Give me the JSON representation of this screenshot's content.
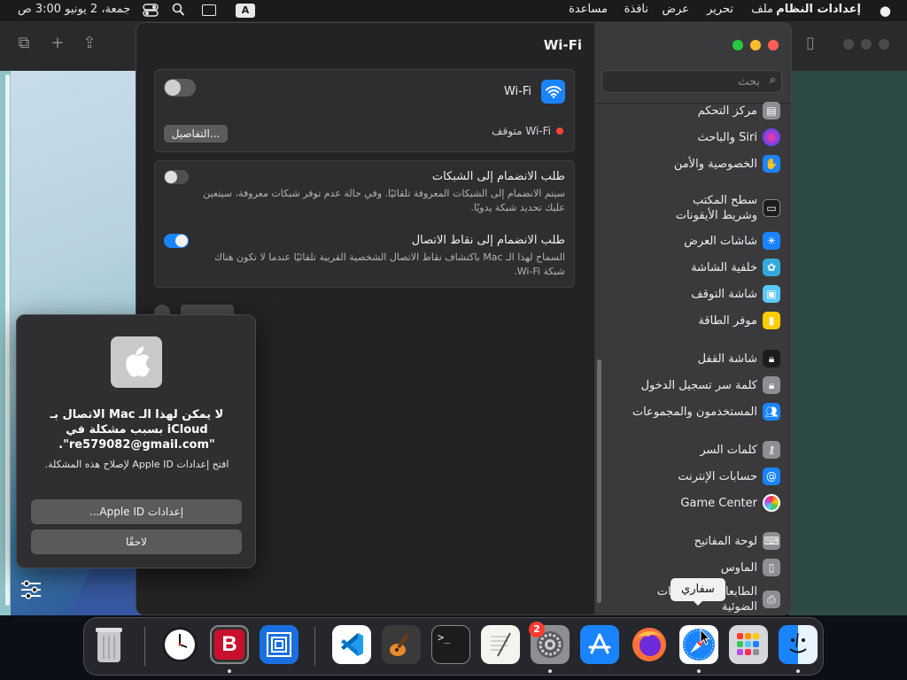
{
  "menubar": {
    "apple": "",
    "app_name": "إعدادات النظام",
    "file": "ملف",
    "edit": "تحرير",
    "view": "عرض",
    "window": "نافذة",
    "help": "مساعدة",
    "input_source": "A",
    "datetime": "جمعة، 2 يونيو  3:00 ص"
  },
  "sidebar": {
    "search_placeholder": "بحث",
    "items": [
      {
        "label": "مركز التحكم",
        "icon": "control-center-icon",
        "color": "#8e8e93"
      },
      {
        "label": "Siri والباحث",
        "icon": "siri-icon",
        "color": "#7b3fe4"
      },
      {
        "label": "الخصوصية والأمن",
        "icon": "privacy-hand-icon",
        "color": "#1a84ff"
      },
      {
        "label": "سطح المكتب وشريط الأيقونات",
        "icon": "dock-icon",
        "color": "#1c1c1e"
      },
      {
        "label": "شاشات العرض",
        "icon": "display-icon",
        "color": "#1a84ff"
      },
      {
        "label": "خلفية الشاشة",
        "icon": "wallpaper-icon",
        "color": "#34aadc"
      },
      {
        "label": "شاشة التوقف",
        "icon": "screensaver-icon",
        "color": "#5ac8fa"
      },
      {
        "label": "موفر الطاقة",
        "icon": "battery-icon",
        "color": "#ffcc00"
      },
      {
        "label": "شاشة القفل",
        "icon": "lock-screen-icon",
        "color": "#1c1c1e"
      },
      {
        "label": "كلمة سر تسجيل الدخول",
        "icon": "lock-icon",
        "color": "#8e8e93"
      },
      {
        "label": "المستخدمون والمجموعات",
        "icon": "users-icon",
        "color": "#1a84ff"
      },
      {
        "label": "كلمات السر",
        "icon": "key-icon",
        "color": "#8e8e93"
      },
      {
        "label": "حسابات الإنترنت",
        "icon": "at-icon",
        "color": "#1a84ff"
      },
      {
        "label": "Game Center",
        "icon": "game-center-icon",
        "color": "#ffffff"
      },
      {
        "label": "لوحة المفاتيح",
        "icon": "keyboard-icon",
        "color": "#8e8e93"
      },
      {
        "label": "الماوس",
        "icon": "mouse-icon",
        "color": "#8e8e93"
      },
      {
        "label": "الطابعات والماسحات الضوئية",
        "icon": "printer-icon",
        "color": "#8e8e93"
      }
    ]
  },
  "content": {
    "title": "Wi-Fi",
    "wifi_label": "Wi-Fi",
    "wifi_on": false,
    "wifi_status": "Wi-Fi متوقف",
    "details_button": "التفاصيل...",
    "ask_join_title": "طلب الانضمام إلى الشبكات",
    "ask_join_desc": "سيتم الانضمام إلى الشبكات المعروفة تلقائيًا. وفي حالة عدم توفر شبكات معروفة، سيتعين عليك تحديد شبكة يدويًا.",
    "ask_join_on": false,
    "hotspot_title": "طلب الانضمام إلى نقاط الاتصال",
    "hotspot_desc": "السماح لهذا الـ Mac باكتشاف نقاط الاتصال الشخصية القريبة تلقائيًا عندما لا تكون هناك شبكة Wi-Fi.",
    "hotspot_on": true
  },
  "dialog": {
    "title": "لا يمكن لهذا الـ Mac الاتصال بـ iCloud بسبب مشكلة في \"re579082@gmail.com\".",
    "message": "افتح إعدادات Apple ID لإصلاح هذه المشكلة.",
    "primary_button": "إعدادات Apple ID...",
    "secondary_button": "لاحقًا"
  },
  "tooltip": "سفاري",
  "dock": {
    "items": [
      "Trash",
      "Clock",
      "Bitdefender",
      "Screens",
      "Visual Studio Code",
      "GarageBand",
      "Terminal",
      "TextEdit",
      "System Settings",
      "App Store",
      "Firefox",
      "Safari",
      "Launchpad",
      "Finder"
    ],
    "badge": "2"
  }
}
